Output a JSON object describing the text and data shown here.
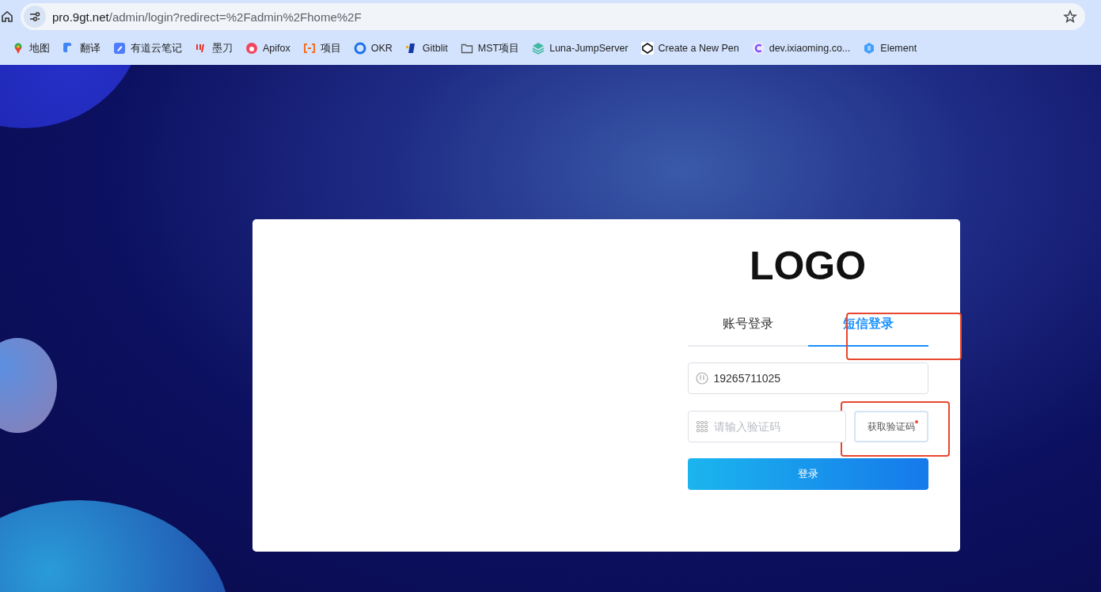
{
  "browser": {
    "url_host": "pro.9gt.net",
    "url_path": "/admin/login?redirect=%2Fadmin%2Fhome%2F",
    "bookmarks": [
      {
        "label": "地图"
      },
      {
        "label": "翻译"
      },
      {
        "label": "有道云笔记"
      },
      {
        "label": "墨刀"
      },
      {
        "label": "Apifox"
      },
      {
        "label": "项目"
      },
      {
        "label": "OKR"
      },
      {
        "label": "Gitblit"
      },
      {
        "label": "MST项目"
      },
      {
        "label": "Luna-JumpServer"
      },
      {
        "label": "Create a New Pen"
      },
      {
        "label": "dev.ixiaoming.co..."
      },
      {
        "label": "Element"
      }
    ]
  },
  "login": {
    "logo": "LOGO",
    "tabs": [
      {
        "label": "账号登录",
        "selected": false,
        "highlighted": false
      },
      {
        "label": "短信登录",
        "selected": true,
        "highlighted": true
      }
    ],
    "phone": {
      "value": "19265711025"
    },
    "code": {
      "placeholder": "请输入验证码"
    },
    "code_button": {
      "label": "获取验证码",
      "highlighted": true
    },
    "submit": {
      "label": "登录"
    }
  }
}
